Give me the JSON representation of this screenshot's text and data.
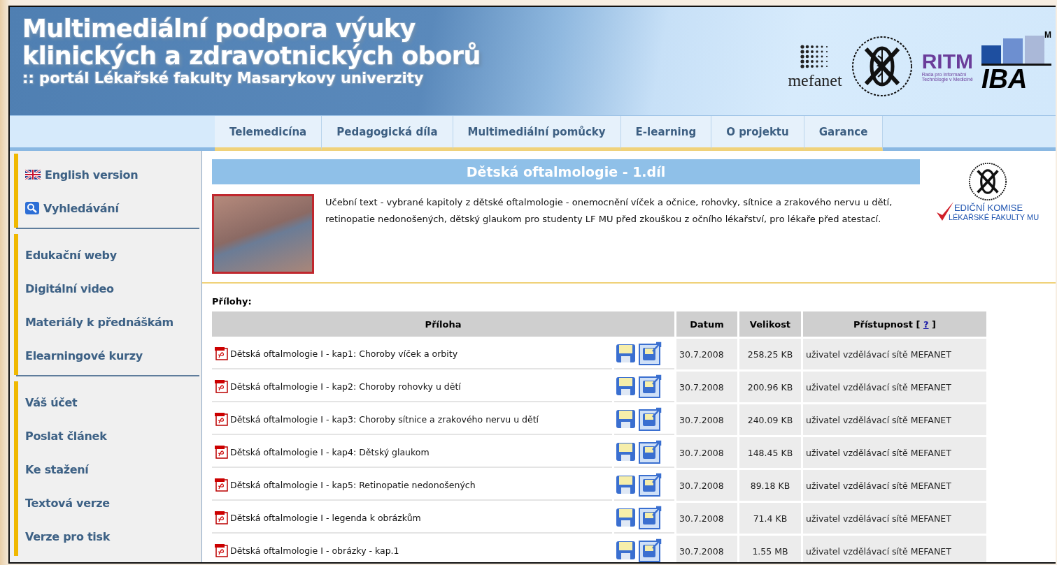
{
  "header": {
    "title_lines": [
      "Multimediální podpora výuky",
      "klinických a zdravotnických oborů"
    ],
    "subtitle": ":: portál Lékařské fakulty Masarykovy univerzity",
    "logos": {
      "mefanet": "mefanet",
      "ritm": {
        "name": "RITM",
        "tagline_lines": [
          "Rada pro Informační",
          "Technologie v Medicíně"
        ]
      },
      "iba": {
        "name": "IBA",
        "corner": "M"
      }
    }
  },
  "nav": {
    "tabs": [
      {
        "label": "Telemedicína"
      },
      {
        "label": "Pedagogická díla"
      },
      {
        "label": "Multimediální pomůcky"
      },
      {
        "label": "E-learning"
      },
      {
        "label": "O projektu"
      },
      {
        "label": "Garance"
      }
    ]
  },
  "sidebar": {
    "groups": [
      {
        "items": [
          {
            "label": "English version",
            "kind": "flag"
          },
          {
            "label": "Vyhledávání",
            "kind": "search"
          }
        ]
      },
      {
        "items": [
          {
            "label": "Edukační weby",
            "kind": "plain"
          },
          {
            "label": "Digitální video",
            "kind": "plain"
          },
          {
            "label": "Materiály k přednáškám",
            "kind": "plain"
          },
          {
            "label": "Elearningové kurzy",
            "kind": "plain"
          }
        ]
      },
      {
        "items": [
          {
            "label": "Váš účet",
            "kind": "plain"
          },
          {
            "label": "Poslat článek",
            "kind": "plain"
          },
          {
            "label": "Ke stažení",
            "kind": "plain"
          },
          {
            "label": "Textová verze",
            "kind": "plain"
          },
          {
            "label": "Verze pro tisk",
            "kind": "plain"
          }
        ]
      }
    ]
  },
  "article": {
    "title": "Dětská oftalmologie - 1.díl",
    "description": "Učební text - vybrané kapitoly z dětské oftalmologie - onemocnění víček a očnice, rohovky, sítnice a zrakového nervu u dětí, retinopatie nedonošených, dětský glaukom pro studenty LF MU před zkouškou z očního lékařství, pro lékaře před atestací.",
    "badge": {
      "line1": "EDIČNÍ KOMISE",
      "line2": "LÉKAŘSKÉ FAKULTY MU"
    }
  },
  "attachments": {
    "label": "Přílohy:",
    "columns": {
      "name": "Příloha",
      "date": "Datum",
      "size": "Velikost",
      "access": {
        "before": "Přístupnost [",
        "link": "?",
        "after": "]"
      }
    },
    "rows": [
      {
        "name": "Dětská oftalmologie I - kap1: Choroby víček a orbity",
        "date": "30.7.2008",
        "size": "258.25 KB",
        "access": "uživatel vzdělávací sítě MEFANET"
      },
      {
        "name": "Dětská oftalmologie I - kap2: Choroby rohovky u dětí",
        "date": "30.7.2008",
        "size": "200.96 KB",
        "access": "uživatel vzdělávací sítě MEFANET"
      },
      {
        "name": "Dětská oftalmologie I - kap3: Choroby sítnice a zrakového nervu u dětí",
        "date": "30.7.2008",
        "size": "240.09 KB",
        "access": "uživatel vzdělávací sítě MEFANET"
      },
      {
        "name": "Dětská oftalmologie I - kap4: Dětský glaukom",
        "date": "30.7.2008",
        "size": "148.45 KB",
        "access": "uživatel vzdělávací sítě MEFANET"
      },
      {
        "name": "Dětská oftalmologie I - kap5: Retinopatie nedonošených",
        "date": "30.7.2008",
        "size": "89.18 KB",
        "access": "uživatel vzdělávací sítě MEFANET"
      },
      {
        "name": "Dětská oftalmologie I - legenda k obrázkům",
        "date": "30.7.2008",
        "size": "71.4 KB",
        "access": "uživatel vzdělávací sítě MEFANET"
      },
      {
        "name": "Dětská oftalmologie I - obrázky - kap.1",
        "date": "30.7.2008",
        "size": "1.55 MB",
        "access": "uživatel vzdělávací sítě MEFANET"
      }
    ]
  }
}
